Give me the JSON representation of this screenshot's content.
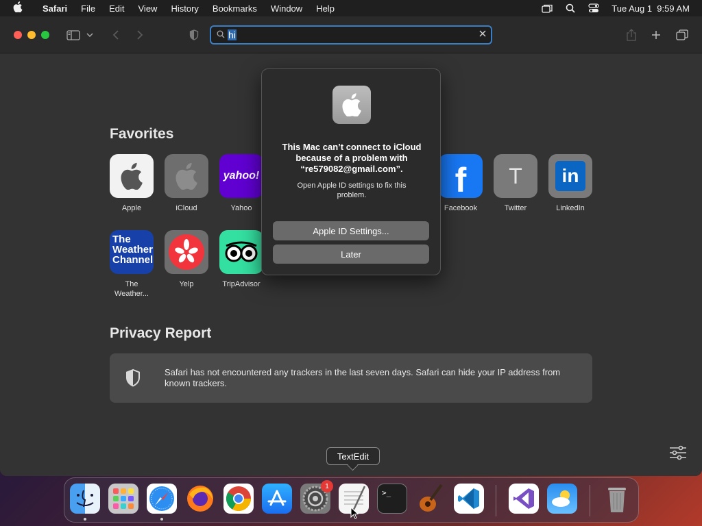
{
  "menubar": {
    "app": "Safari",
    "items": [
      "File",
      "Edit",
      "View",
      "History",
      "Bookmarks",
      "Window",
      "Help"
    ],
    "datetime": "Tue Aug 1  9:59 AM"
  },
  "toolbar": {
    "address_value": "hi"
  },
  "favorites": {
    "title": "Favorites",
    "items": [
      {
        "label": "Apple"
      },
      {
        "label": "iCloud"
      },
      {
        "label": "Yahoo",
        "tile_text": "yahoo!"
      },
      {
        "label": "Facebook",
        "tile_text": "f"
      },
      {
        "label": "Twitter",
        "tile_text": "T"
      },
      {
        "label": "LinkedIn",
        "tile_text": "in"
      },
      {
        "label": "The Weather...",
        "tile_text": "The Weather Channel"
      },
      {
        "label": "Yelp"
      },
      {
        "label": "TripAdvisor"
      }
    ]
  },
  "privacy": {
    "title": "Privacy Report",
    "text": "Safari has not encountered any trackers in the last seven days. Safari can hide your IP address from known trackers."
  },
  "dialog": {
    "message": "This Mac can’t connect to iCloud because of a problem with “re579082@gmail.com”.",
    "info": "Open Apple ID settings to fix this problem.",
    "primary_button": "Apple ID Settings...",
    "secondary_button": "Later"
  },
  "tooltip": {
    "text": "TextEdit"
  },
  "dock": {
    "badge_count": "1",
    "apps": [
      "finder-icon",
      "launchpad-icon",
      "safari-icon",
      "firefox-icon",
      "chrome-icon",
      "app-store-icon",
      "system-settings-icon",
      "textedit-icon",
      "terminal-icon",
      "garageband-icon",
      "vscode-icon",
      "visual-studio-icon",
      "weather-icon",
      "trash-icon"
    ]
  },
  "colors": {
    "accent": "#3a7fc4",
    "window_bg": "#333333",
    "card_bg": "#4a4a4a"
  }
}
